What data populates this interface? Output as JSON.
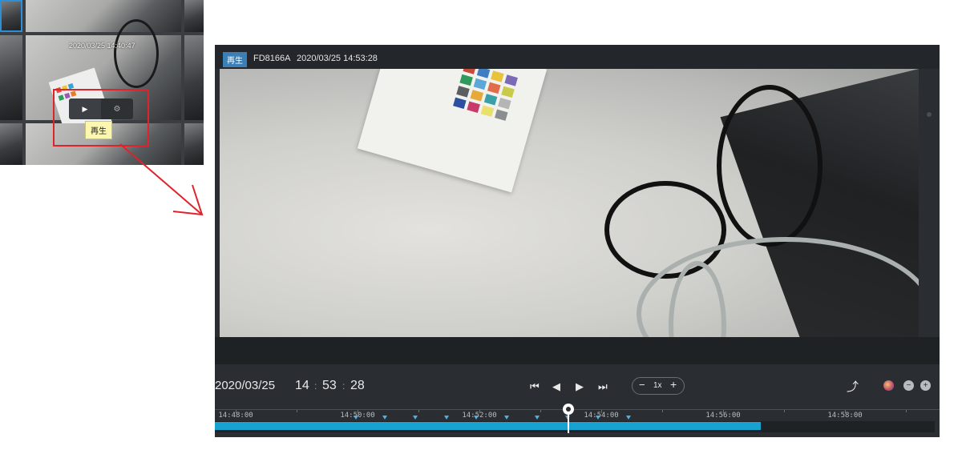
{
  "thumbnail": {
    "timestamp": "2020/03/25 14:40:47",
    "tooltip": "再生",
    "play_icon": "play-icon",
    "settings_icon": "gear-icon"
  },
  "player": {
    "badge": "再生",
    "camera": "FD8166A",
    "timestamp": "2020/03/25 14:53:28",
    "date": "2020/03/25",
    "hour": "14",
    "minute": "53",
    "second": "28",
    "colon": ":",
    "controls": {
      "skip_start": "⏮",
      "step_back": "◀",
      "play": "▶",
      "skip_end": "⏭",
      "speed_minus": "−",
      "speed_value": "1x",
      "speed_plus": "+",
      "share": "⤴",
      "zoom_out": "−",
      "zoom_in": "+"
    },
    "timeline": {
      "labels": [
        "14:48:00",
        "14:50:00",
        "14:52:00",
        "14:54:00",
        "14:56:00",
        "14:58:00"
      ],
      "recorded_fraction": 0.758,
      "cursor_time": "14:53:28"
    }
  },
  "colors": {
    "accent": "#18a2cf",
    "badge": "#3a7fb5",
    "highlight": "#e0232a"
  }
}
